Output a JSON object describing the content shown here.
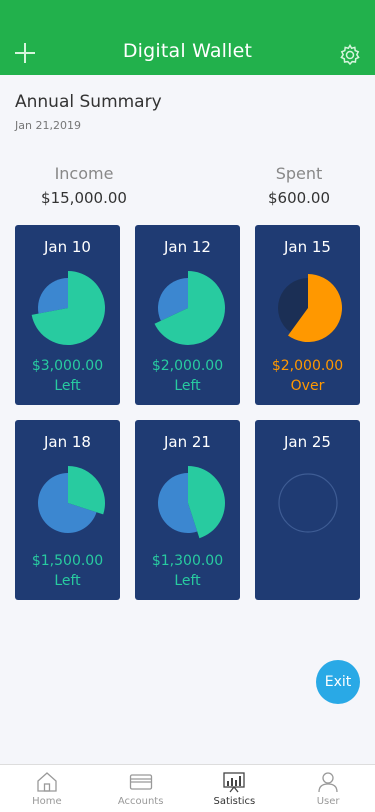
{
  "header": {
    "title": "Digital Wallet",
    "left_icon": "plus-icon",
    "right_icon": "gear-icon"
  },
  "summary": {
    "title": "Annual Summary",
    "date": "Jan 21,2019"
  },
  "stats": {
    "income_label": "Income",
    "income_value": "$15,000.00",
    "spent_label": "Spent",
    "spent_value": "$600.00"
  },
  "colors": {
    "header": "#22b14c",
    "card": "#1f3b73",
    "left": "#28cba0",
    "over": "#ff9800",
    "spent_slice": "#3c87d0",
    "exit": "#29a9e6"
  },
  "cards": [
    {
      "date": "Jan 10",
      "amount": "$3,000.00",
      "status": "Left",
      "kind": "left",
      "fraction": 0.72
    },
    {
      "date": "Jan 12",
      "amount": "$2,000.00",
      "status": "Left",
      "kind": "left",
      "fraction": 0.68
    },
    {
      "date": "Jan 15",
      "amount": "$2,000.00",
      "status": "Over",
      "kind": "over",
      "fraction": 0.6
    },
    {
      "date": "Jan 18",
      "amount": "$1,500.00",
      "status": "Left",
      "kind": "left",
      "fraction": 0.3
    },
    {
      "date": "Jan 21",
      "amount": "$1,300.00",
      "status": "Left",
      "kind": "left",
      "fraction": 0.45
    },
    {
      "date": "Jan 25",
      "amount": "",
      "status": "",
      "kind": "empty",
      "fraction": 0
    }
  ],
  "exit_label": "Exit",
  "tabs": [
    {
      "label": "Home",
      "icon": "home-icon"
    },
    {
      "label": "Accounts",
      "icon": "credit-card-icon"
    },
    {
      "label": "Satistics",
      "icon": "chart-icon"
    },
    {
      "label": "User",
      "icon": "user-icon"
    }
  ]
}
